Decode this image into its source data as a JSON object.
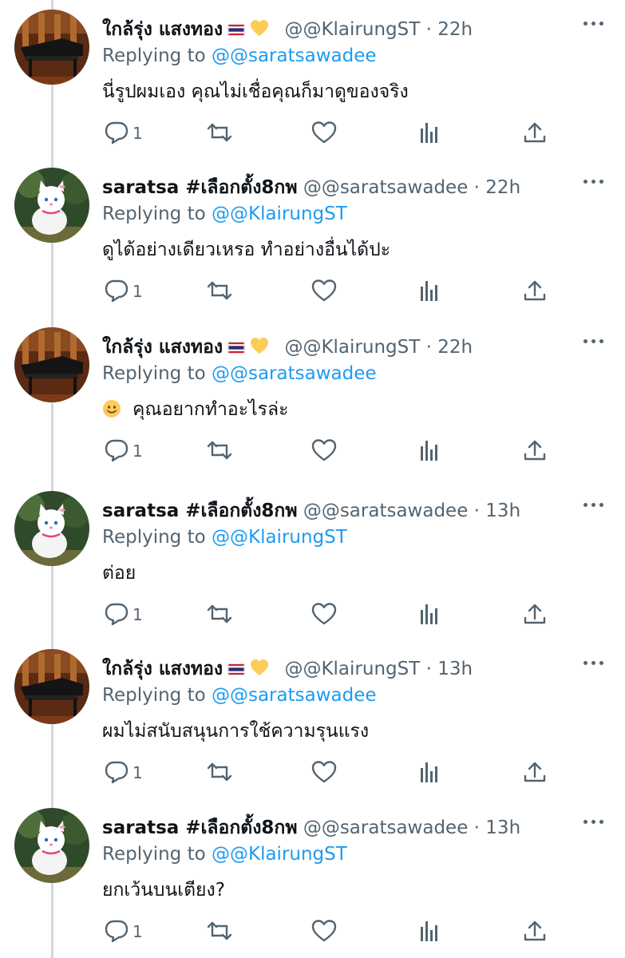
{
  "users": {
    "klairung": {
      "name": "ใกล้รุ่ง แสงทอง",
      "handle": "@@KlairungST",
      "flag_icon": "thailand-flag-icon",
      "emoji_icon": "yellow-heart-icon"
    },
    "saratsa": {
      "name": "saratsa #เลือกตั้ง8กพ",
      "handle": "@@saratsawadee"
    }
  },
  "labels": {
    "replying_prefix": "Replying to",
    "dot": "·"
  },
  "tweets": [
    {
      "author": "klairung",
      "name": "ใกล้รุ่ง แสงทอง",
      "handle": "@@KlairungST",
      "time": "22h",
      "replying_to": "@@saratsawadee",
      "text": "นี่รูปผมเอง คุณไม่เชื่อคุณก็มาดูของจริง",
      "reply_count": "1"
    },
    {
      "author": "saratsa",
      "name": "saratsa #เลือกตั้ง8กพ",
      "handle": "@@saratsawadee",
      "time": "22h",
      "replying_to": "@@KlairungST",
      "text": "ดูได้อย่างเดียวเหรอ ทำอย่างอื่นได้ปะ",
      "reply_count": "1"
    },
    {
      "author": "klairung",
      "name": "ใกล้รุ่ง แสงทอง",
      "handle": "@@KlairungST",
      "time": "22h",
      "replying_to": "@@saratsawadee",
      "text": "คุณอยากทำอะไรล่ะ",
      "leading_emoji": "smiling-face-icon",
      "reply_count": "1"
    },
    {
      "author": "saratsa",
      "name": "saratsa #เลือกตั้ง8กพ",
      "handle": "@@saratsawadee",
      "time": "13h",
      "replying_to": "@@KlairungST",
      "text": "ต่อย",
      "reply_count": "1"
    },
    {
      "author": "klairung",
      "name": "ใกล้รุ่ง แสงทอง",
      "handle": "@@KlairungST",
      "time": "13h",
      "replying_to": "@@saratsawadee",
      "text": "ผมไม่สนับสนุนการใช้ความรุนแรง",
      "reply_count": "1"
    },
    {
      "author": "saratsa",
      "name": "saratsa #เลือกตั้ง8กพ",
      "handle": "@@saratsawadee",
      "time": "13h",
      "replying_to": "@@KlairungST",
      "text": "ยกเว้นบนเตียง?",
      "reply_count": "1"
    }
  ],
  "colors": {
    "text": "#0f1419",
    "muted": "#536471",
    "link": "#1d9bf0",
    "thread_line": "#cfd9de"
  },
  "icons": {
    "more": "more-dots-icon",
    "reply": "reply-bubble-icon",
    "retweet": "retweet-icon",
    "like": "heart-outline-icon",
    "views": "views-bars-icon",
    "share": "share-upload-icon"
  }
}
